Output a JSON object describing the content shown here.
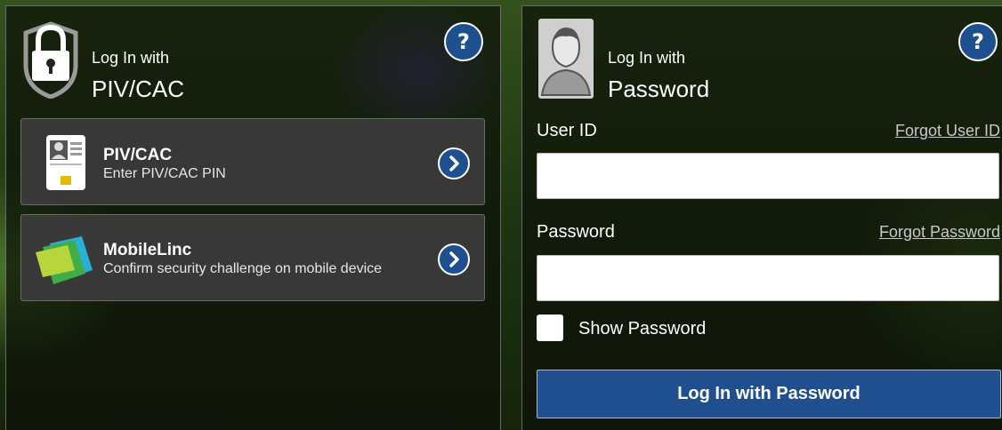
{
  "colors": {
    "accent": "#1e4f8f",
    "panel_bg": "#0c1208",
    "option_bg": "#3c3c3c"
  },
  "piv_panel": {
    "heading_small": "Log In with",
    "heading_big": "PIV/CAC",
    "help_label": "?",
    "lock_icon": "lock-shield-icon",
    "options": [
      {
        "title": "PIV/CAC",
        "description": "Enter PIV/CAC PIN",
        "icon": "id-card-icon"
      },
      {
        "title": "MobileLinc",
        "description": "Confirm security challenge on mobile device",
        "icon": "mobilelinc-logo-icon"
      }
    ]
  },
  "password_panel": {
    "heading_small": "Log In with",
    "heading_big": "Password",
    "help_label": "?",
    "user_icon": "user-avatar-icon",
    "user_id_label": "User ID",
    "forgot_user_id": "Forgot User ID",
    "user_id_value": "",
    "password_label": "Password",
    "forgot_password": "Forgot Password",
    "password_value": "",
    "show_password_label": "Show Password",
    "show_password_checked": false,
    "submit_label": "Log In with Password"
  }
}
